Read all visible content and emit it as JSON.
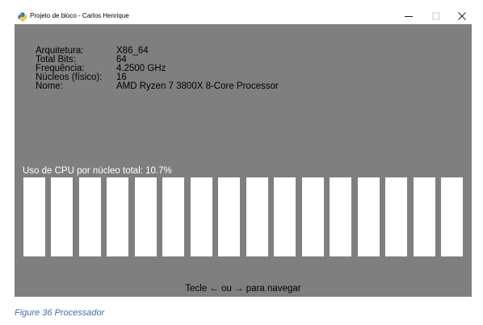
{
  "window": {
    "title": "Projeto de bloco - Carlos Henrique",
    "icon": "python-icon"
  },
  "info": {
    "rows": [
      {
        "label": "Arquitetura:",
        "value": "X86_64"
      },
      {
        "label": "Total Bits:",
        "value": "64"
      },
      {
        "label": "Frequência:",
        "value": "4.2500 GHz"
      },
      {
        "label": "Núcleos (físico):",
        "value": "16"
      },
      {
        "label": "Nome:",
        "value": "AMD Ryzen 7 3800X 8-Core Processor"
      }
    ]
  },
  "cpu": {
    "total_label": "Uso de CPU por núcleo total: 10.7%",
    "core_count": 16,
    "core_usage_percent": [
      0,
      0,
      0,
      0,
      0,
      0,
      0,
      0,
      0,
      0,
      0,
      0,
      0,
      0,
      0,
      0
    ]
  },
  "nav_hint": "Tecle ← ou → para navegar",
  "caption": "Figure 36 Processador",
  "colors": {
    "canvas_background": "#7f7f7f",
    "core_bar": "#ffffff",
    "caption": "#3d6fae"
  }
}
